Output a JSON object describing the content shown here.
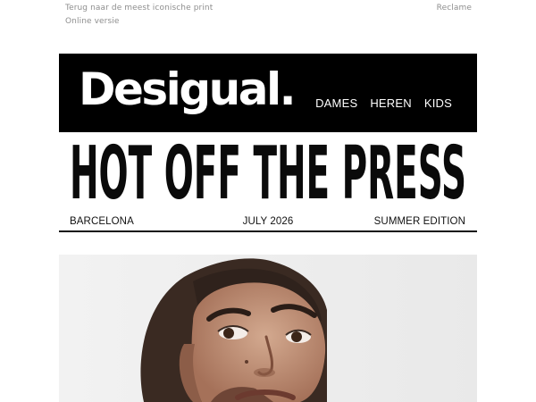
{
  "preheader": {
    "back_link": "Terug naar de meest iconische print",
    "online_link": "Online versie",
    "ad_label": "Reclame"
  },
  "header": {
    "logo_text": "Desigual.",
    "nav": [
      "DAMES",
      "HEREN",
      "KIDS"
    ],
    "background": "#000000"
  },
  "headline": {
    "text": "HOT OFF THE PRESS"
  },
  "dateline": {
    "city": "BARCELONA",
    "date": "JULY 2026",
    "edition": "SUMMER EDITION"
  },
  "hero": {
    "image": "woman-portrait"
  }
}
